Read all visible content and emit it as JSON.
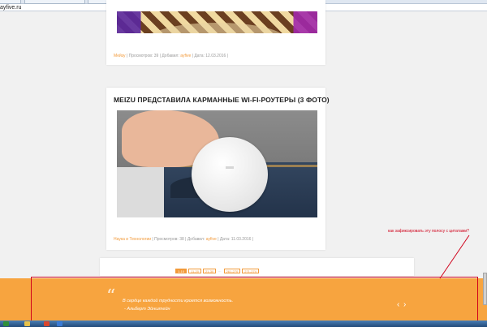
{
  "browser": {
    "url": "ayfive.ru",
    "tabs": [
      {},
      {},
      {},
      {},
      {}
    ]
  },
  "articles": [
    {
      "title": "",
      "image": "carousel-photo",
      "meta": {
        "category": "Мейзу",
        "views_label": "Просмотров:",
        "views": "39",
        "added_label": "Добавил:",
        "author": "ayfive",
        "date_label": "Дата:",
        "date": "12.03.2016"
      }
    },
    {
      "title": "MEIZU ПРЕДСТАВИЛА КАРМАННЫЕ WI-FI-РОУТЕРЫ (3 ФОТО)",
      "image": "wifi-router-in-pocket-photo",
      "meta": {
        "category": "Наука и Технологии",
        "views_label": "Просмотров:",
        "views": "38",
        "added_label": "Добавил:",
        "author": "ayfive",
        "date_label": "Дата:",
        "date": "11.03.2016"
      }
    }
  ],
  "pagination": {
    "pages": [
      {
        "label": "1-10",
        "active": true
      },
      {
        "label": "11-20",
        "active": false
      },
      {
        "label": "21-30",
        "active": false
      },
      {
        "label": "...",
        "active": false
      },
      {
        "label": "261-270",
        "active": false
      },
      {
        "label": "271-274",
        "active": false
      }
    ]
  },
  "annotation": {
    "text": "как зафиксировать эту полосу с цитатами?",
    "color": "#d0021b"
  },
  "quote_band": {
    "mark": "“",
    "text": "В сердце каждой трудности кроется возможность.",
    "author": "- Альберт Эйнштейн",
    "prev": "‹",
    "next": "›",
    "background": "#f7a43f"
  },
  "colors": {
    "accent": "#f29a3a",
    "page_background": "#f1f1f1"
  }
}
